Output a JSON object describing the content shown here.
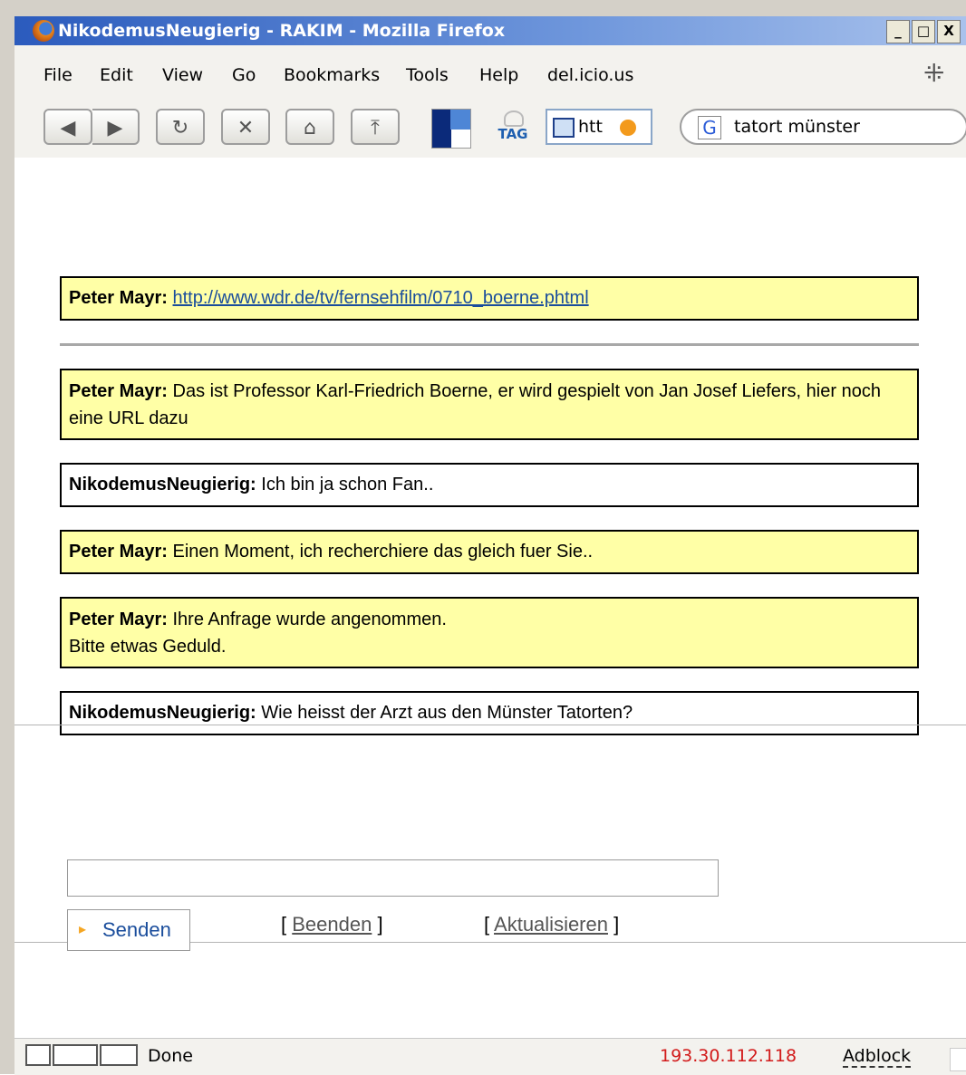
{
  "window": {
    "title": "NikodemusNeugierig - RAKIM - Mozilla Firefox",
    "buttons": [
      "_",
      "□",
      "X"
    ]
  },
  "menu": {
    "items": [
      "File",
      "Edit",
      "View",
      "Go",
      "Bookmarks",
      "Tools",
      "Help",
      "del.icio.us"
    ]
  },
  "toolbar": {
    "back_label": "◀",
    "forward_label": "▶",
    "reload_label": "↻",
    "stop_label": "✕",
    "home_label": "⌂",
    "bookmark_label": "⤒",
    "tag_label": "TAG",
    "address_text": "htt",
    "search_engine_icon": "G",
    "search_value": "tatort münster"
  },
  "chat": {
    "messages": [
      {
        "sender": "Peter Mayr:",
        "text": "",
        "link": "http://www.wdr.de/tv/fernsehfilm/0710_boerne.phtml",
        "type": "agent"
      },
      {
        "sender": "Peter Mayr:",
        "text": "Das ist Professor Karl-Friedrich Boerne, er wird gespielt von Jan Josef Liefers, hier noch eine URL dazu",
        "type": "agent"
      },
      {
        "sender": "NikodemusNeugierig:",
        "text": "Ich bin ja schon Fan..",
        "type": "user"
      },
      {
        "sender": "Peter Mayr:",
        "text": "Einen Moment, ich recherchiere das gleich fuer Sie..",
        "type": "agent"
      },
      {
        "sender": "Peter Mayr:",
        "text": "Ihre Anfrage wurde angenommen.",
        "text2": "Bitte etwas Geduld.",
        "type": "agent"
      },
      {
        "sender": "NikodemusNeugierig:",
        "text": "Wie heisst der Arzt aus den Münster Tatorten?",
        "type": "user"
      }
    ]
  },
  "form": {
    "input_value": "",
    "send_label": "Senden",
    "send_arrow": "▸",
    "quit_label": "Beenden",
    "refresh_label": "Aktualisieren",
    "bracket_open": "[",
    "bracket_close": "]"
  },
  "statusbar": {
    "status_text": "Done",
    "ip": "193.30.112.118",
    "adblock": "Adblock"
  }
}
